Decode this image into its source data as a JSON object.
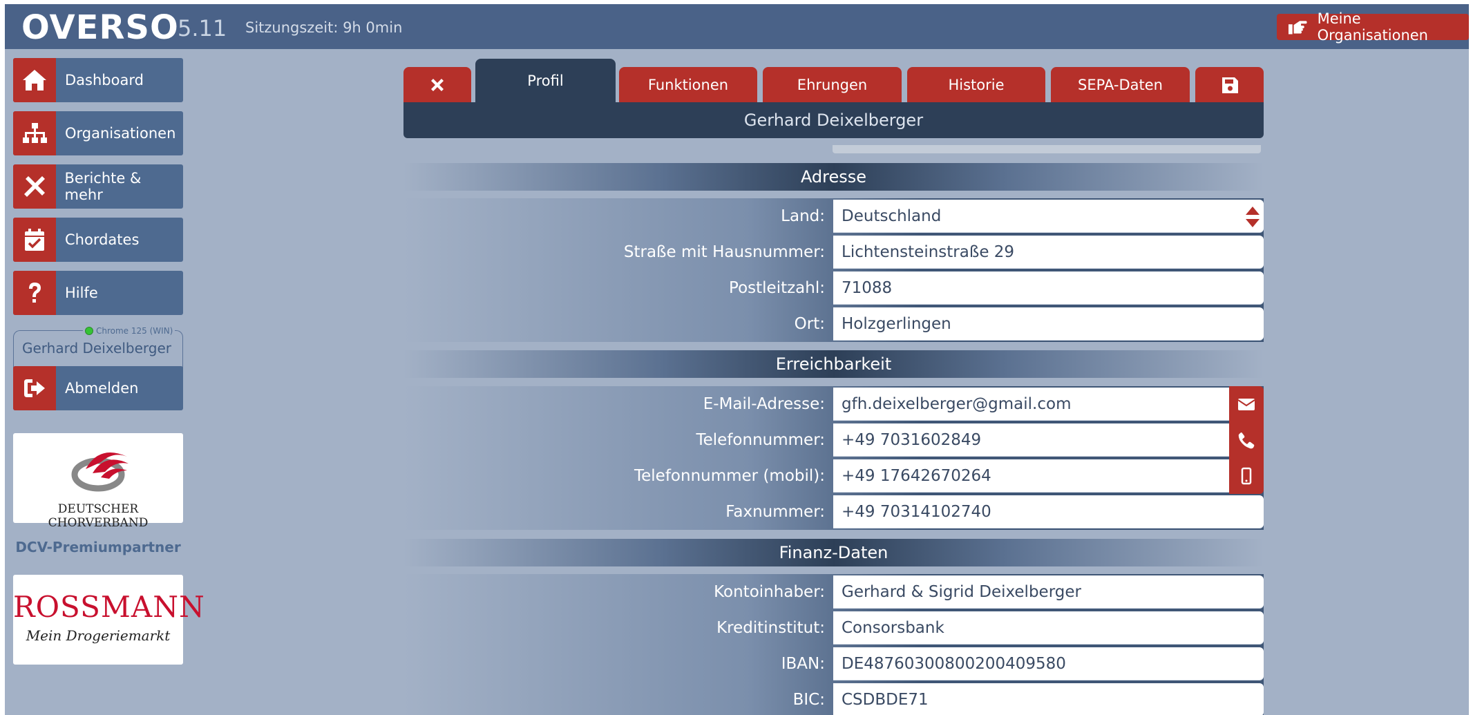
{
  "app": {
    "logo": "OVERSO",
    "version": "5.11",
    "session": "Sitzungszeit: 9h 0min",
    "my_orgs": "Meine Organisationen"
  },
  "sidebar": {
    "items": [
      {
        "label": "Dashboard",
        "icon": "home-icon"
      },
      {
        "label": "Organisationen",
        "icon": "sitemap-icon"
      },
      {
        "label": "Berichte & mehr",
        "icon": "tools-icon"
      },
      {
        "label": "Chordates",
        "icon": "calendar-check-icon"
      },
      {
        "label": "Hilfe",
        "icon": "question-icon"
      }
    ],
    "browser": "Chrome 125 (WIN)",
    "user": "Gerhard Deixelberger",
    "logout": "Abmelden",
    "dcv_logo_text": "Deutscher Chorverband",
    "partner": "DCV-Premiumpartner",
    "rossmann_text": "ROSSMANN",
    "rossmann_sub": "Mein Drogeriemarkt"
  },
  "tabs": {
    "profil": "Profil",
    "funktionen": "Funktionen",
    "ehrungen": "Ehrungen",
    "historie": "Historie",
    "sepa": "SEPA-Daten"
  },
  "header": {
    "name": "Gerhard Deixelberger"
  },
  "sections": {
    "adresse": {
      "title": "Adresse",
      "rows": [
        {
          "label": "Land:",
          "value": "Deutschland"
        },
        {
          "label": "Straße mit Hausnummer:",
          "value": "Lichtensteinstraße 29"
        },
        {
          "label": "Postleitzahl:",
          "value": "71088"
        },
        {
          "label": "Ort:",
          "value": "Holzgerlingen"
        }
      ]
    },
    "erreichbarkeit": {
      "title": "Erreichbarkeit",
      "rows": [
        {
          "label": "E-Mail-Adresse:",
          "value": "gfh.deixelberger@gmail.com"
        },
        {
          "label": "Telefonnummer:",
          "value": "+49 7031602849"
        },
        {
          "label": "Telefonnummer (mobil):",
          "value": "+49 17642670264"
        },
        {
          "label": "Faxnummer:",
          "value": "+49 70314102740"
        }
      ]
    },
    "finanz": {
      "title": "Finanz-Daten",
      "rows": [
        {
          "label": "Kontoinhaber:",
          "value": "Gerhard & Sigrid Deixelberger"
        },
        {
          "label": "Kreditinstitut:",
          "value": "Consorsbank"
        },
        {
          "label": "IBAN:",
          "value": "DE48760300800200409580"
        },
        {
          "label": "BIC:",
          "value": "CSDBDE71"
        }
      ]
    }
  },
  "colors": {
    "accent_red": "#b5302a",
    "navy": "#2d3f57",
    "topbar": "#4a6288",
    "background": "#a3b1c6"
  }
}
